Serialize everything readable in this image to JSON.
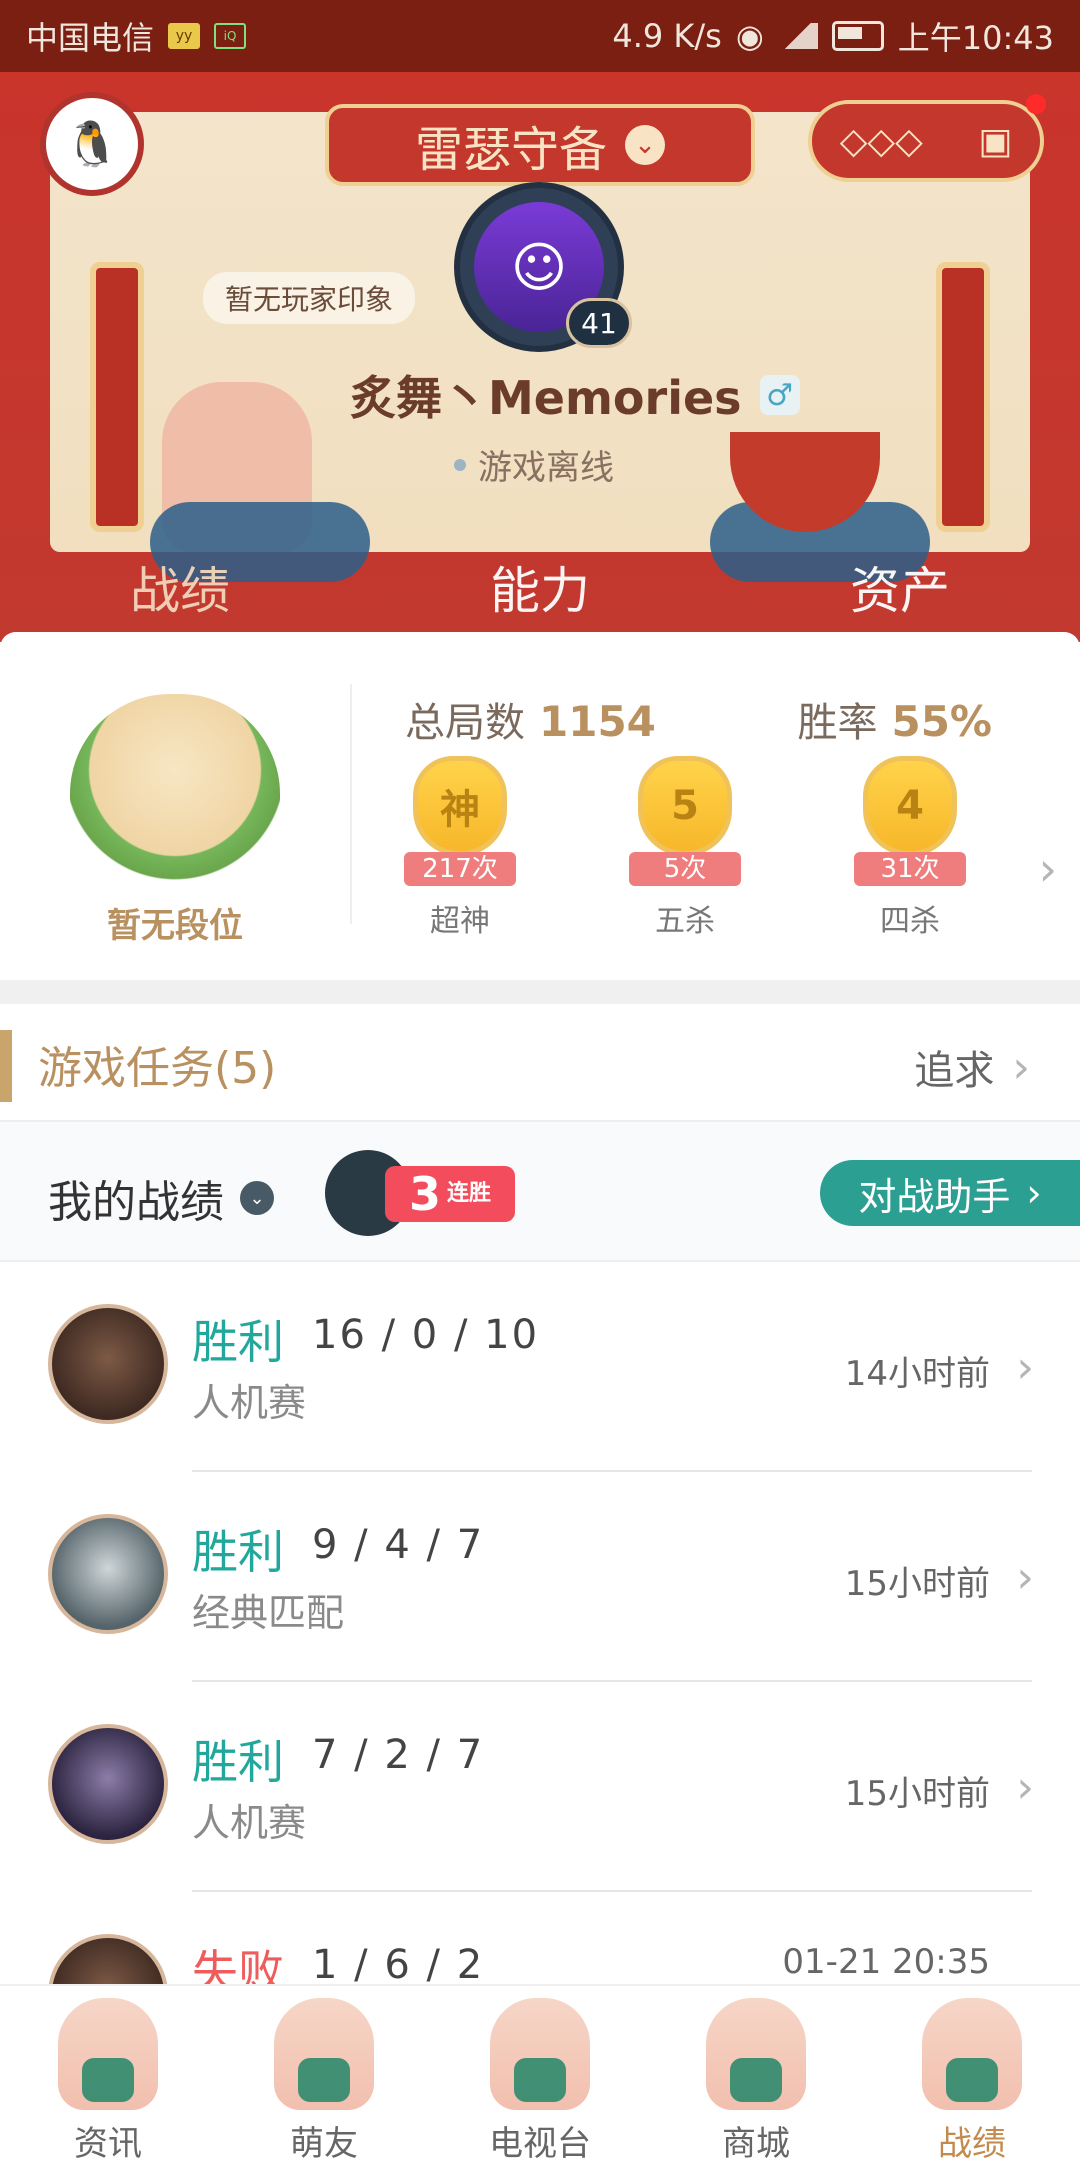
{
  "status_bar": {
    "carrier": "中国电信",
    "speed": "4.9 K/s",
    "time": "上午10:43"
  },
  "header": {
    "title": "雷瑟守备",
    "impression": "暂无玩家印象",
    "level": "41",
    "nickname": "炙舞丶Memories",
    "status": "游戏离线",
    "tabs": [
      "战绩",
      "能力",
      "资产"
    ]
  },
  "stats": {
    "rank_text": "暂无段位",
    "total_label": "总局数",
    "total_value": "1154",
    "winrate_label": "胜率",
    "winrate_value": "55%",
    "badges": [
      {
        "symbol": "神",
        "count": "217次",
        "name": "超神"
      },
      {
        "symbol": "5",
        "count": "5次",
        "name": "五杀"
      },
      {
        "symbol": "4",
        "count": "31次",
        "name": "四杀"
      }
    ]
  },
  "tasks": {
    "label": "游戏任务(5)",
    "more": "追求"
  },
  "my_record": {
    "label": "我的战绩",
    "streak_num": "3",
    "streak_text": "连胜",
    "assistant": "对战助手"
  },
  "matches": [
    {
      "result": "胜利",
      "kda": "16 / 0 / 10",
      "mode": "人机赛",
      "time": "14小时前"
    },
    {
      "result": "胜利",
      "kda": "9 / 4 / 7",
      "mode": "经典匹配",
      "time": "15小时前"
    },
    {
      "result": "胜利",
      "kda": "7 / 2 / 7",
      "mode": "人机赛",
      "time": "15小时前"
    },
    {
      "result": "失败",
      "kda": "1 / 6 / 2",
      "mode": "",
      "time": "01-21 20:35"
    }
  ],
  "bottom_nav": [
    "资讯",
    "萌友",
    "电视台",
    "商城",
    "战绩"
  ]
}
